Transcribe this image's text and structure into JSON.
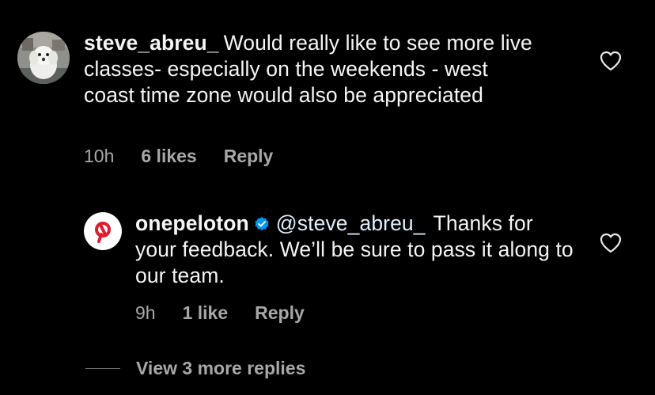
{
  "colors": {
    "background": "#000000",
    "text": "#f5f5f5",
    "muted": "#a8a8a8",
    "brand_red": "#df1c2f",
    "verified_blue": "#0095f6"
  },
  "comments": [
    {
      "username": "steve_abreu_",
      "text": "Would really like to see more live classes- especially on the weekends - west coast time zone would also be appreciated",
      "time": "10h",
      "likes": "6 likes",
      "reply_label": "Reply",
      "avatar_icon": "dog-photo-avatar",
      "like_icon": "heart-outline-icon"
    }
  ],
  "reply": {
    "username": "onepeloton",
    "verified": true,
    "verified_icon": "verified-badge-icon",
    "mention": "@steve_abreu_",
    "text": "Thanks for your feedback. We’ll be sure to pass it along to our team.",
    "time": "9h",
    "likes": "1 like",
    "reply_label": "Reply",
    "avatar_icon": "peloton-logo-icon",
    "like_icon": "heart-outline-icon"
  },
  "view_more_replies": "View 3 more replies"
}
